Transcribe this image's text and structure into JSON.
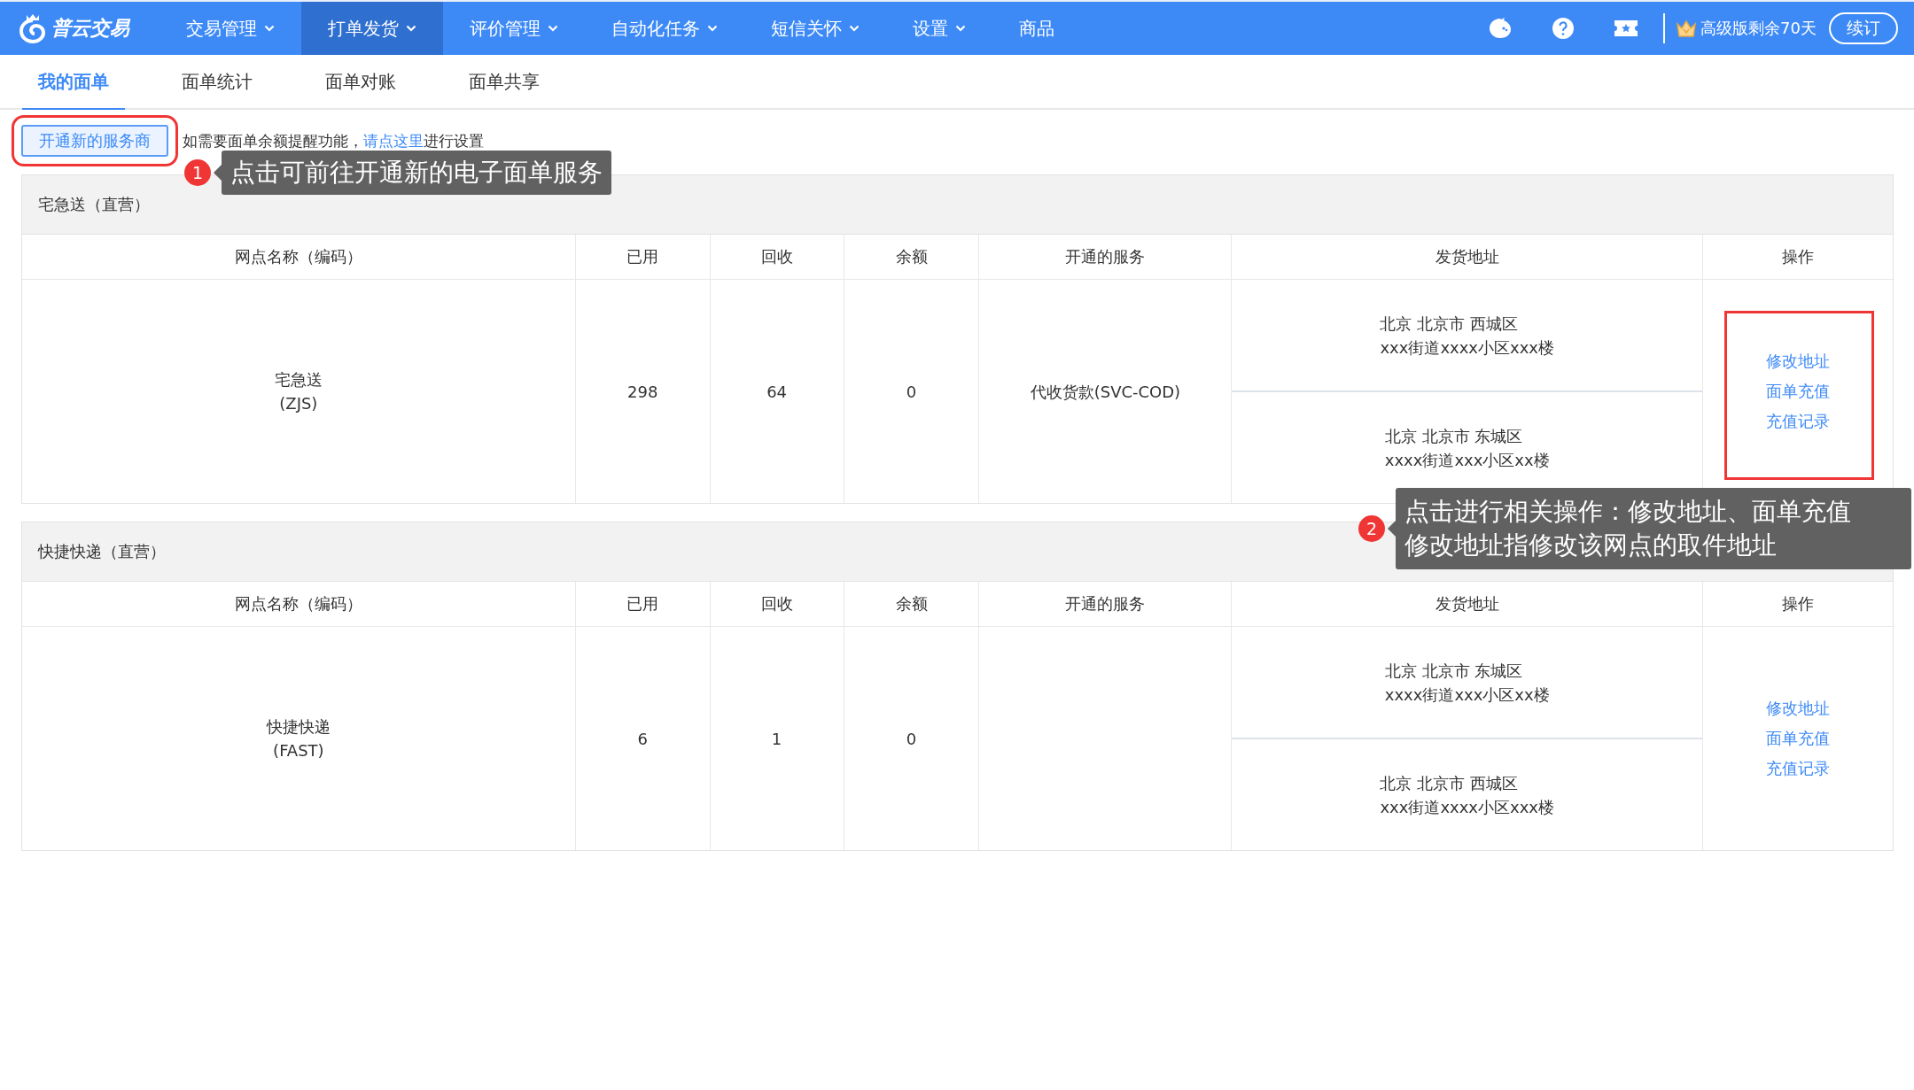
{
  "nav": {
    "logo": "普云交易",
    "menus": [
      {
        "label": "交易管理",
        "dropdown": true,
        "selected": false
      },
      {
        "label": "打单发货",
        "dropdown": true,
        "selected": true
      },
      {
        "label": "评价管理",
        "dropdown": true,
        "selected": false
      },
      {
        "label": "自动化任务",
        "dropdown": true,
        "selected": false
      },
      {
        "label": "短信关怀",
        "dropdown": true,
        "selected": false
      },
      {
        "label": "设置",
        "dropdown": true,
        "selected": false
      },
      {
        "label": "商品",
        "dropdown": false,
        "selected": false
      }
    ],
    "plan": "高级版剩余70天",
    "renew": "续订"
  },
  "tabs": [
    {
      "label": "我的面单",
      "selected": true
    },
    {
      "label": "面单统计",
      "selected": false
    },
    {
      "label": "面单对账",
      "selected": false
    },
    {
      "label": "面单共享",
      "selected": false
    }
  ],
  "toolbar": {
    "button": "开通新的服务商",
    "button_highlighted": true,
    "notice_before": "如需要面单余额提醒功能，",
    "link": "请点这里",
    "notice_after": "进行设置"
  },
  "groups": [
    {
      "title": "宅急送（直营）",
      "columns": [
        "网点名称（编码）",
        "已用",
        "回收",
        "余额",
        "开通的服务",
        "发货地址",
        "操作"
      ],
      "rows": [
        {
          "name": "宅急送",
          "code": "(ZJS)",
          "used": "298",
          "recycled": "64",
          "balance": "0",
          "service": "代收货款(SVC-COD)",
          "addresses": [
            {
              "region": "北京 北京市 西城区",
              "street": "xxx街道xxxx小区xxx楼"
            },
            {
              "region": "北京 北京市 东城区",
              "street": "xxxx街道xxx小区xx楼"
            }
          ],
          "actions": [
            "修改地址",
            "面单充值",
            "充值记录"
          ],
          "actions_highlighted": true
        }
      ]
    },
    {
      "title": "快捷快递（直营）",
      "columns": [
        "网点名称（编码）",
        "已用",
        "回收",
        "余额",
        "开通的服务",
        "发货地址",
        "操作"
      ],
      "rows": [
        {
          "name": "快捷快递",
          "code": "(FAST)",
          "used": "6",
          "recycled": "1",
          "balance": "0",
          "service": "",
          "addresses": [
            {
              "region": "北京 北京市 东城区",
              "street": "xxxx街道xxx小区xx楼"
            },
            {
              "region": "北京 北京市 西城区",
              "street": "xxx街道xxxx小区xxx楼"
            }
          ],
          "actions": [
            "修改地址",
            "面单充值",
            "充值记录"
          ],
          "actions_highlighted": false
        }
      ]
    }
  ],
  "annotations": [
    {
      "number": "1",
      "lines": [
        "点击可前往开通新的电子面单服务"
      ]
    },
    {
      "number": "2",
      "lines": [
        "点击进行相关操作：修改地址、面单充值",
        "修改地址指修改该网点的取件地址"
      ]
    }
  ]
}
